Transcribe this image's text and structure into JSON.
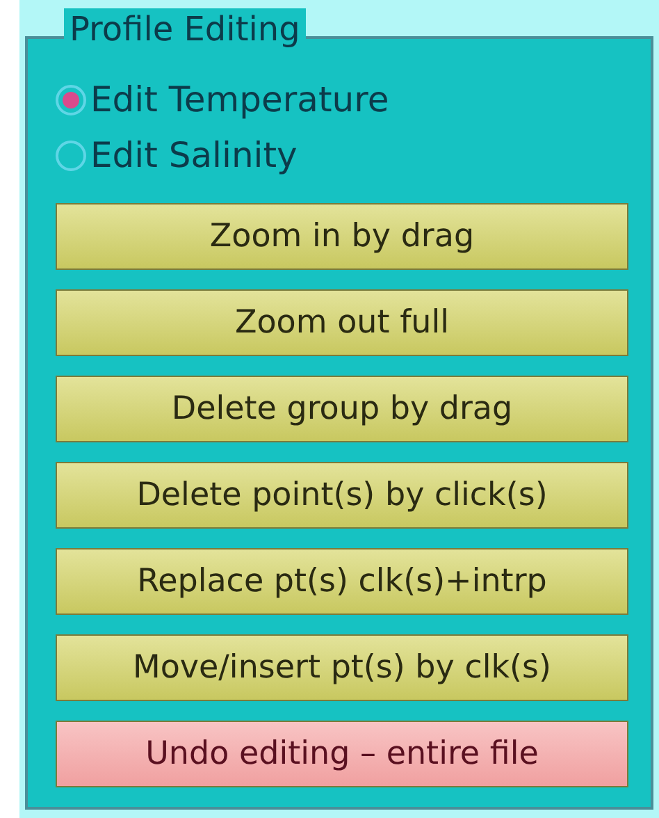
{
  "panel": {
    "title": "Profile Editing"
  },
  "radios": [
    {
      "label": "Edit Temperature",
      "selected": true
    },
    {
      "label": "Edit Salinity",
      "selected": false
    }
  ],
  "buttons": [
    {
      "label": "Zoom in by drag",
      "kind": "normal"
    },
    {
      "label": "Zoom out full",
      "kind": "normal"
    },
    {
      "label": "Delete group by drag",
      "kind": "normal"
    },
    {
      "label": "Delete point(s) by click(s)",
      "kind": "normal"
    },
    {
      "label": "Replace pt(s) clk(s)+intrp",
      "kind": "normal"
    },
    {
      "label": "Move/insert pt(s) by clk(s)",
      "kind": "normal"
    },
    {
      "label": "Undo editing – entire file",
      "kind": "danger"
    }
  ]
}
